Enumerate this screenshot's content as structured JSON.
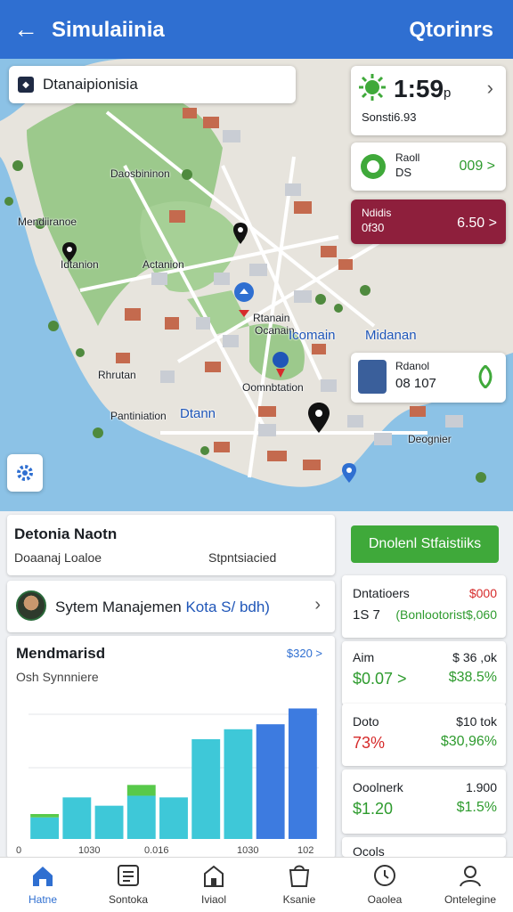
{
  "header": {
    "title": "Simulaiinia",
    "action": "Qtorinrs"
  },
  "search": {
    "value": "Dtanaipionisia"
  },
  "map": {
    "labels": [
      "Daosbininon",
      "Mendiiranoe",
      "Idtanion",
      "Actanion",
      "Rhrutan",
      "Pantiniation",
      "Dtann",
      "Oomnbtation",
      "Rtanain",
      "Ocanain",
      "Deognier"
    ],
    "domain_label": "Icomain",
    "midanan_label": "Midanan"
  },
  "time_card": {
    "time": "1:59",
    "suffix": "p",
    "sub": "Sonsti6.93"
  },
  "rank_card": {
    "line1": "Raoll",
    "line2": "DS",
    "value": "009 >"
  },
  "alert_card": {
    "line1": "Ndidis",
    "line2": "0f30",
    "value": "6.50 >"
  },
  "domain_card": {
    "line1": "Rdanol",
    "line2": "08  107"
  },
  "detail": {
    "title": "Detonia Naotn",
    "left": "Doaanaj Loaloe",
    "right": "Stpntsiacied"
  },
  "user": {
    "name": "Sytem Manajemen",
    "link": "Kota S/ bdh)"
  },
  "chart_panel": {
    "title": "Mendmarisd",
    "subtitle": "Osh Synnniere",
    "link": "$320 >"
  },
  "chart_data": {
    "type": "bar",
    "categories": [
      "1",
      "2",
      "3",
      "4",
      "5",
      "6",
      "7",
      "8",
      "9"
    ],
    "series": [
      {
        "values": [
          26,
          50,
          40,
          52,
          50,
          120,
          132,
          138,
          157
        ]
      },
      {
        "values": [
          4,
          0,
          0,
          13,
          0,
          0,
          0,
          0,
          0
        ]
      }
    ],
    "tick_labels": [
      "0",
      "1030",
      "0.016",
      "1030",
      "102"
    ],
    "colors": [
      "#3ec8d8",
      "#58c94a",
      "#3d7be0"
    ],
    "ylim": [
      0,
      180
    ]
  },
  "green_button": {
    "label": "Dnolenl  Stfaistiiks"
  },
  "stats": [
    {
      "left": "Dntatioers",
      "right": "$000",
      "big": "1S 7",
      "rbig": "(Bonlootorist$,060"
    },
    {
      "left": "Aim",
      "right": "$ 36 ,ok",
      "big": "$0.07 >",
      "rbig": "$38.5%"
    },
    {
      "left": "Doto",
      "right": "$10 tok",
      "big": "73%",
      "rbig": "$30,96%"
    },
    {
      "left": "Ooolnerk",
      "right": "1.900",
      "big": "$1.20",
      "rbig": "$1.5%"
    },
    {
      "left": "Ocols",
      "right": "",
      "big": "",
      "rbig": ""
    }
  ],
  "nav": [
    {
      "label": "Hatne",
      "icon": "home-icon"
    },
    {
      "label": "Sontoka",
      "icon": "list-icon"
    },
    {
      "label": "Iviaol",
      "icon": "store-icon"
    },
    {
      "label": "Ksanie",
      "icon": "bag-icon"
    },
    {
      "label": "Oaolea",
      "icon": "clock-icon"
    },
    {
      "label": "Ontelegine",
      "icon": "person-icon"
    }
  ]
}
